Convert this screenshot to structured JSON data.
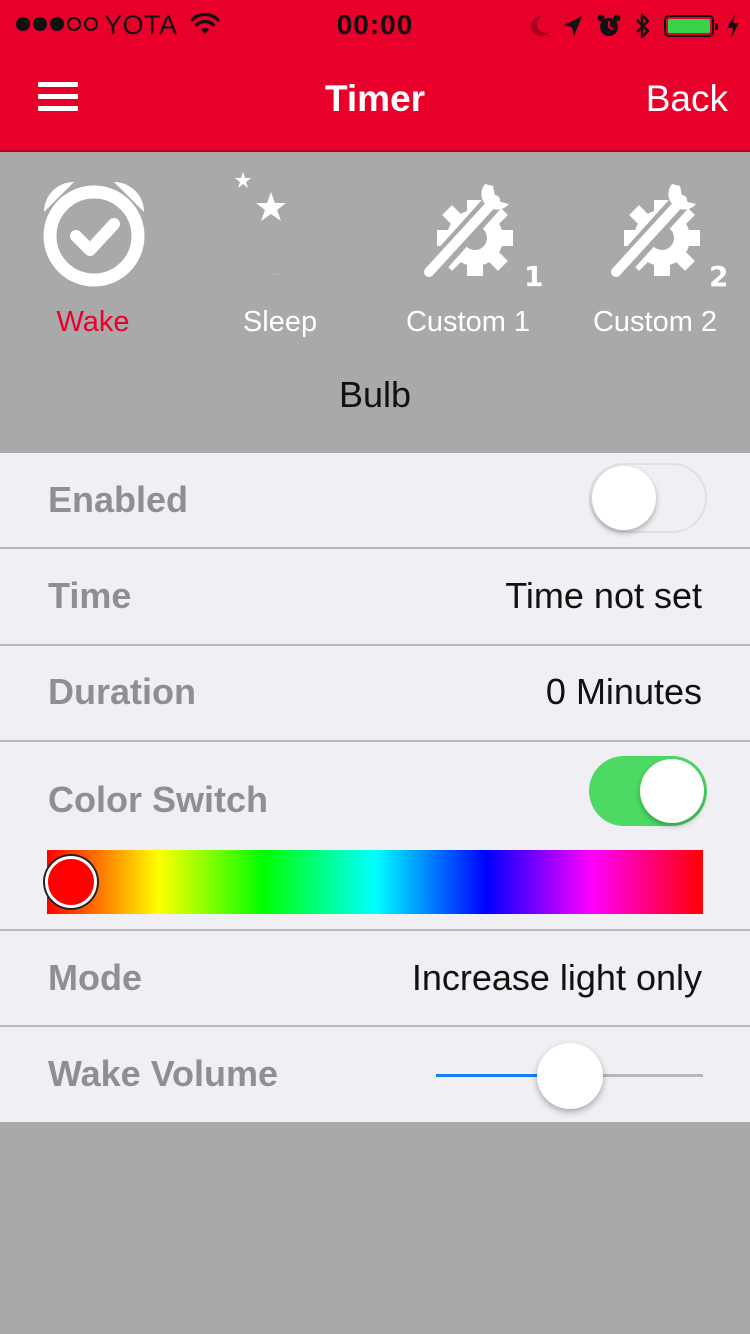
{
  "status_bar": {
    "signal_bars_filled": 3,
    "signal_bars_total": 5,
    "carrier": "YOTA",
    "time": "00:00",
    "icons": [
      "wifi-icon",
      "moon-icon",
      "location-arrow-icon",
      "alarm-clock-icon",
      "bluetooth-icon",
      "battery-icon",
      "charging-bolt-icon"
    ],
    "battery_level": 1.0
  },
  "nav": {
    "menu_icon": "hamburger-menu-icon",
    "title": "Timer",
    "back_label": "Back"
  },
  "tabs": [
    {
      "label": "Wake",
      "icon": "alarm-clock-icon",
      "active": true
    },
    {
      "label": "Sleep",
      "icon": "moon-stars-icon",
      "active": false
    },
    {
      "label": "Custom 1",
      "icon": "tools-gear-icon",
      "badge": "1",
      "active": false
    },
    {
      "label": "Custom 2",
      "icon": "tools-gear-icon",
      "badge": "2",
      "active": false
    }
  ],
  "device_label": "Bulb",
  "settings": {
    "enabled": {
      "label": "Enabled",
      "on": false
    },
    "time": {
      "label": "Time",
      "value": "Time not set"
    },
    "duration": {
      "label": "Duration",
      "value": "0 Minutes"
    },
    "color_switch": {
      "label": "Color Switch",
      "on": true,
      "hue_position": 0.0
    },
    "mode": {
      "label": "Mode",
      "value": "Increase light only"
    },
    "wake_volume": {
      "label": "Wake Volume",
      "level": 0.5
    }
  },
  "colors": {
    "brand_red": "#e8002a",
    "switch_on": "#4cd964",
    "slider_fill": "#147efb",
    "panel_gray": "#a9a9a9",
    "list_bg": "#efeff4"
  }
}
